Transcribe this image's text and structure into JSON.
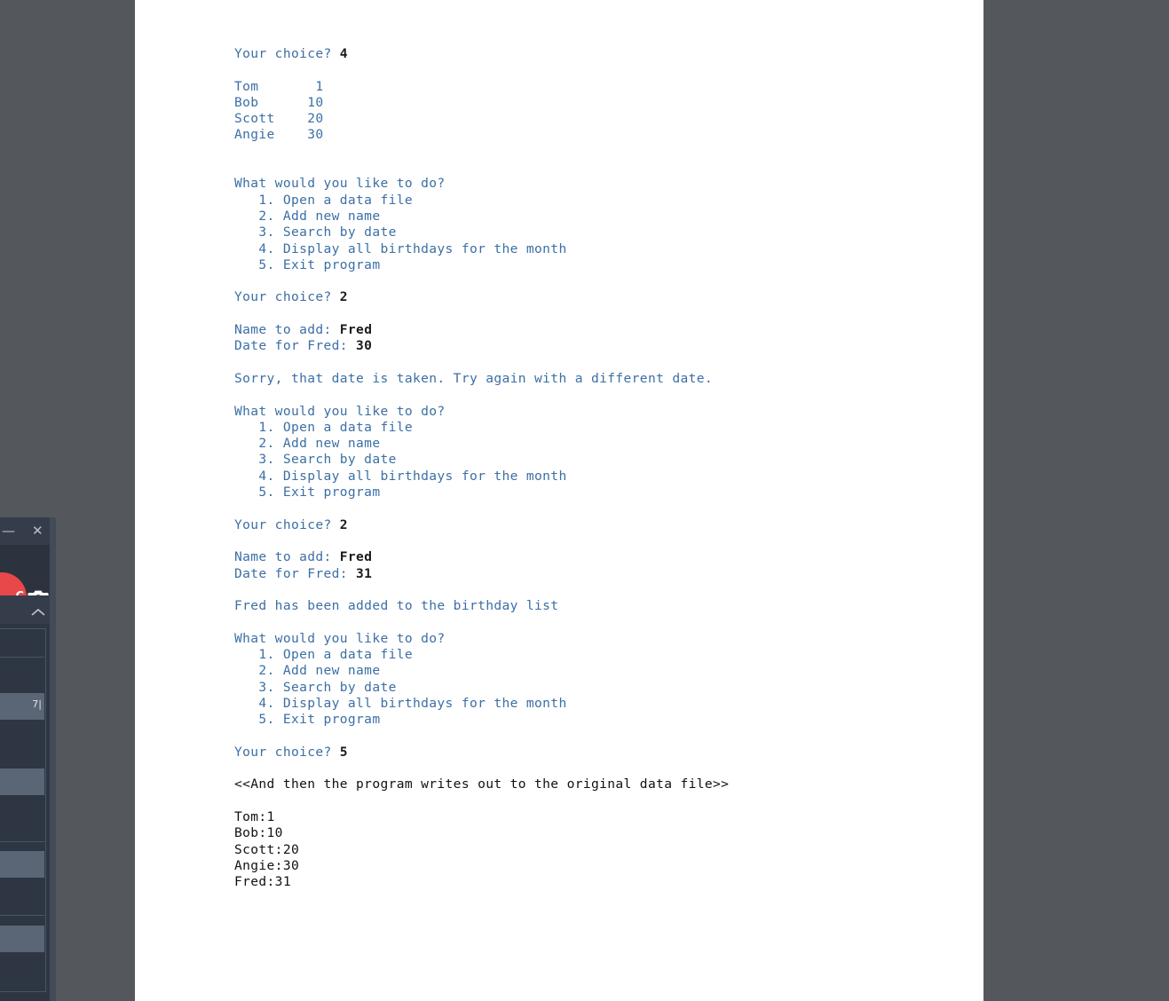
{
  "theme": {
    "page_background": "#ffffff",
    "desktop_background": "#54585c",
    "output_text_color": "#3c6fa5",
    "input_text_color": "#1b1b1b",
    "file_text_color": "#111111",
    "recorder_panel_background": "#2e3643",
    "record_button_color": "#e8484a"
  },
  "document": {
    "transcript": [
      {
        "type": "prompt",
        "prompt": "Your choice? ",
        "input": "4"
      },
      {
        "type": "blank"
      },
      {
        "type": "record",
        "name": "Tom",
        "date": "1"
      },
      {
        "type": "record",
        "name": "Bob",
        "date": "10"
      },
      {
        "type": "record",
        "name": "Scott",
        "date": "20"
      },
      {
        "type": "record",
        "name": "Angie",
        "date": "30"
      },
      {
        "type": "blank"
      },
      {
        "type": "blank"
      },
      {
        "type": "output",
        "text": "What would you like to do?"
      },
      {
        "type": "output",
        "text": "   1. Open a data file"
      },
      {
        "type": "output",
        "text": "   2. Add new name"
      },
      {
        "type": "output",
        "text": "   3. Search by date"
      },
      {
        "type": "output",
        "text": "   4. Display all birthdays for the month"
      },
      {
        "type": "output",
        "text": "   5. Exit program"
      },
      {
        "type": "blank"
      },
      {
        "type": "prompt",
        "prompt": "Your choice? ",
        "input": "2"
      },
      {
        "type": "blank"
      },
      {
        "type": "prompt",
        "prompt": "Name to add: ",
        "input": "Fred"
      },
      {
        "type": "prompt",
        "prompt": "Date for Fred: ",
        "input": "30"
      },
      {
        "type": "blank"
      },
      {
        "type": "output",
        "text": "Sorry, that date is taken. Try again with a different date."
      },
      {
        "type": "blank"
      },
      {
        "type": "output",
        "text": "What would you like to do?"
      },
      {
        "type": "output",
        "text": "   1. Open a data file"
      },
      {
        "type": "output",
        "text": "   2. Add new name"
      },
      {
        "type": "output",
        "text": "   3. Search by date"
      },
      {
        "type": "output",
        "text": "   4. Display all birthdays for the month"
      },
      {
        "type": "output",
        "text": "   5. Exit program"
      },
      {
        "type": "blank"
      },
      {
        "type": "prompt",
        "prompt": "Your choice? ",
        "input": "2"
      },
      {
        "type": "blank"
      },
      {
        "type": "prompt",
        "prompt": "Name to add: ",
        "input": "Fred"
      },
      {
        "type": "prompt",
        "prompt": "Date for Fred: ",
        "input": "31"
      },
      {
        "type": "blank"
      },
      {
        "type": "output",
        "text": "Fred has been added to the birthday list"
      },
      {
        "type": "blank"
      },
      {
        "type": "output",
        "text": "What would you like to do?"
      },
      {
        "type": "output",
        "text": "   1. Open a data file"
      },
      {
        "type": "output",
        "text": "   2. Add new name"
      },
      {
        "type": "output",
        "text": "   3. Search by date"
      },
      {
        "type": "output",
        "text": "   4. Display all birthdays for the month"
      },
      {
        "type": "output",
        "text": "   5. Exit program"
      },
      {
        "type": "blank"
      },
      {
        "type": "prompt",
        "prompt": "Your choice? ",
        "input": "5"
      },
      {
        "type": "blank"
      },
      {
        "type": "plain",
        "text": "<<And then the program writes out to the original data file>>"
      },
      {
        "type": "blank"
      },
      {
        "type": "plain",
        "text": "Tom:1"
      },
      {
        "type": "plain",
        "text": "Bob:10"
      },
      {
        "type": "plain",
        "text": "Scott:20"
      },
      {
        "type": "plain",
        "text": "Angie:30"
      },
      {
        "type": "plain",
        "text": "Fred:31"
      }
    ]
  },
  "recorder": {
    "window_title": "",
    "minimize_label": "—",
    "close_label": "✕",
    "record_label": "C",
    "camera_icon": "camera-icon",
    "collapse_icon": "chevron-up-icon",
    "fields": [
      {
        "value": "7|"
      },
      {
        "value": ""
      },
      {
        "value": ""
      },
      {
        "value": ""
      }
    ]
  }
}
